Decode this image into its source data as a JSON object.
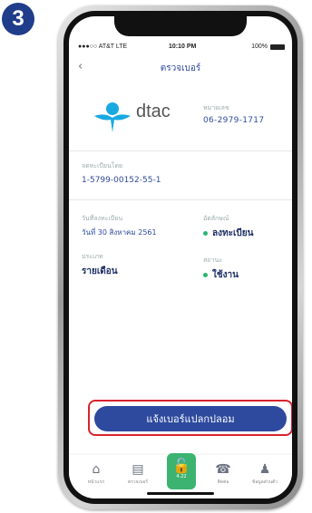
{
  "step_badge": "3",
  "status_bar": {
    "carrier": "●●●○○ AT&T LTE",
    "wifi_icon": "wifi-icon",
    "time": "10:10 PM",
    "battery_percent": "100%"
  },
  "nav": {
    "back_icon": "‹",
    "title": "ตรวจเบอร์"
  },
  "operator": {
    "logo_text": "dtac",
    "number_label": "หมายเลข",
    "number_value": "06-2979-1717"
  },
  "fields": {
    "id_label": "จดทะเบียนโดย",
    "id_value": "1-5799-00152-55-1",
    "reg_date_label": "วันที่ลงทะเบียน",
    "reg_date_value": "วันที่ 30 สิงหาคม 2561",
    "identity_label": "อัตลักษณ์",
    "identity_value": "ลงทะเบียน",
    "type_label": "ประเภท",
    "type_value": "รายเดือน",
    "status_label": "สถานะ",
    "status_value": "ใช้งาน"
  },
  "report_button": "แจ้งเบอร์แปลกปลอม",
  "tabs": [
    {
      "label": "หน้าแรก",
      "icon": "home-icon"
    },
    {
      "label": "ตรวจเบอร์",
      "icon": "id-card-icon"
    },
    {
      "label": "ติดต่อ",
      "icon": "phone-chat-icon"
    },
    {
      "label": "ข้อมูลส่วนตัว",
      "icon": "user-icon"
    }
  ],
  "center_lock": {
    "label": "4.22",
    "icon": "lock-icon"
  },
  "colors": {
    "primary": "#2d4a9e",
    "highlight": "#d9232d",
    "lock_green": "#3cb371",
    "status_dot": "#2bb673"
  }
}
